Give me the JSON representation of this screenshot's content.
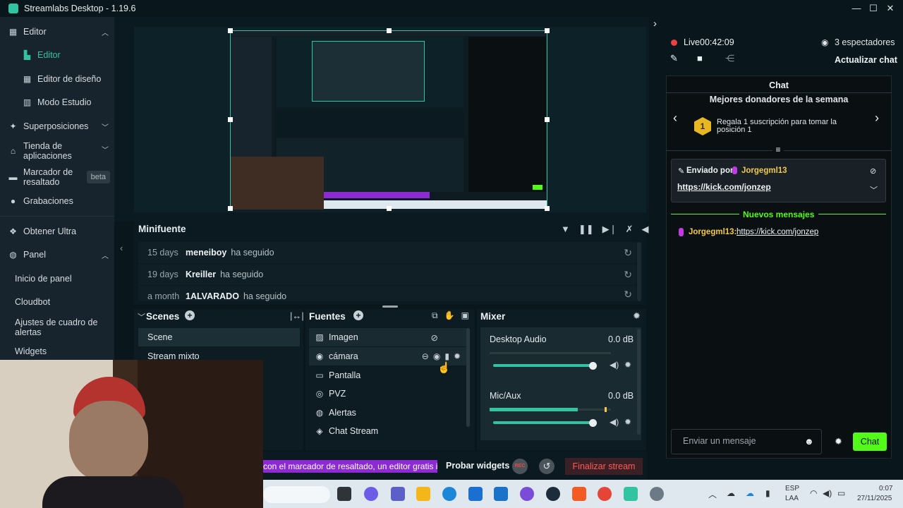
{
  "window": {
    "title": "Streamlabs Desktop - 1.19.6"
  },
  "sidebar": {
    "items": [
      {
        "label": "Editor",
        "expanded": true
      },
      {
        "label": "Editor"
      },
      {
        "label": "Editor de diseño"
      },
      {
        "label": "Modo Estudio"
      },
      {
        "label": "Superposiciones"
      },
      {
        "label": "Tienda de aplicaciones"
      },
      {
        "label": "Marcador de resaltado",
        "badge": "beta"
      },
      {
        "label": "Grabaciones"
      },
      {
        "label": "Obtener Ultra"
      },
      {
        "label": "Panel"
      },
      {
        "label": "Inicio de panel"
      },
      {
        "label": "Cloudbot"
      },
      {
        "label": "Ajustes de cuadro de alertas"
      },
      {
        "label": "Widgets"
      }
    ]
  },
  "minifuente": {
    "title": "Minifuente",
    "events": [
      {
        "when": "15 days",
        "who": "meneiboy",
        "what": "ha seguido"
      },
      {
        "when": "19 days",
        "who": "Kreiller",
        "what": "ha seguido"
      },
      {
        "when": "a month",
        "who": "1ALVARADO",
        "what": "ha seguido"
      }
    ]
  },
  "scenes": {
    "title": "Scenes",
    "items": [
      "Scene",
      "Stream mixto"
    ]
  },
  "sources": {
    "title": "Fuentes",
    "items": [
      "Imagen",
      "cámara",
      "Pantalla",
      "PVZ",
      "Alertas",
      "Chat Stream"
    ]
  },
  "mixer": {
    "title": "Mixer",
    "channels": [
      {
        "name": "Desktop Audio",
        "db": "0.0 dB",
        "level": 0.0,
        "volume": 0.97
      },
      {
        "name": "Mic/Aux",
        "db": "0.0 dB",
        "level": 0.58,
        "volume": 0.97
      }
    ]
  },
  "footer": {
    "ticker": "con el marcador de resaltado, un editor gratis in",
    "probar": "Probar widgets",
    "rec": "REC",
    "finalizar": "Finalizar stream"
  },
  "live": {
    "label": "Live",
    "time": "00:42:09",
    "viewers": "3 espectadores",
    "refresh": "Actualizar chat"
  },
  "chat": {
    "title": "Chat",
    "donors_title": "Mejores donadores de la semana",
    "donor_rank": "1",
    "donor_text": "Regala 1 suscripción para tomar la posición 1",
    "pinned_prefix": "Enviado por",
    "pinned_user": "Jorgegml13",
    "pinned_link": "https://kick.com/jonzep",
    "new_messages": "Nuevos mensajes",
    "message_user": "Jorgegml13:",
    "message_link": "https://kick.com/jonzep",
    "input_placeholder": "Enviar un mensaje",
    "send": "Chat"
  },
  "taskbar": {
    "lang1": "ESP",
    "lang2": "LAA",
    "time": "0:07",
    "date": "27/11/2025"
  },
  "colors": {
    "accent": "#31c3a2",
    "chat_green": "#53fc18",
    "live_red": "#f04040",
    "finalizar_red": "#e34a4a",
    "ticker_purple": "#8b2bd1"
  }
}
